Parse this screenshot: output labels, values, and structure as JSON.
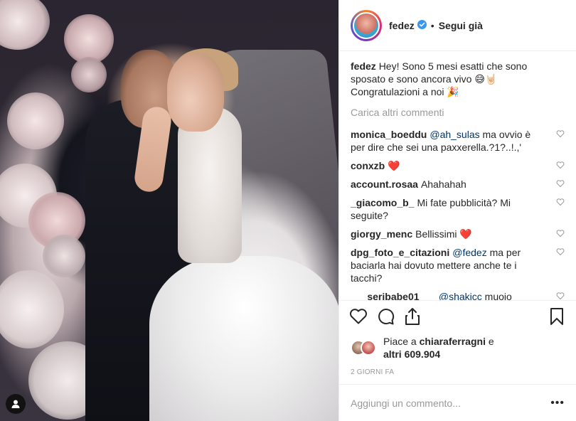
{
  "header": {
    "username": "fedez",
    "separator": "•",
    "follow_label": "Segui già"
  },
  "caption": {
    "username": "fedez",
    "text": "Hey! Sono 5 mesi esatti che sono sposato e sono ancora vivo 😅🤘🏻 Congratulazioni a noi 🎉"
  },
  "load_more_label": "Carica altri commenti",
  "comments": [
    {
      "user": "monica_boeddu",
      "mention": "@ah_sulas",
      "text": " ma ovvio è per dire che sei una paxxerella.?1?..!.,'"
    },
    {
      "user": "conxzb",
      "mention": "",
      "text": "❤️"
    },
    {
      "user": "account.rosaa",
      "mention": "",
      "text": "Ahahahah"
    },
    {
      "user": "_giacomo_b_",
      "mention": "",
      "text": "Mi fate pubblicità? Mi seguite?"
    },
    {
      "user": "giorgy_menc",
      "mention": "",
      "text": "Bellissimi ❤️"
    },
    {
      "user": "dpg_foto_e_citazioni",
      "mention": "@fedez",
      "text": " ma per baciarla hai dovuto mettere anche te i tacchi?"
    },
    {
      "user": "___seribabe01___",
      "mention": "@shakicc",
      "text": " muoio Cristina Ahahahahahahahahahahah"
    }
  ],
  "likes": {
    "prefix": "Piace a ",
    "user": "chiaraferragni",
    "middle": " e",
    "others": "altri 609.904"
  },
  "timestamp": "2 giorni fa",
  "add_comment": {
    "placeholder": "Aggiungi un commento..."
  },
  "more_label": "•••",
  "icons": {
    "verified": "verified-badge-icon",
    "like": "heart-outline-icon",
    "comment": "comment-bubble-icon",
    "share": "share-upload-icon",
    "save": "bookmark-icon",
    "comment_like": "small-heart-icon",
    "tag": "user-tag-icon"
  },
  "colors": {
    "verified_blue": "#3897f0",
    "heart_red": "#ed4956",
    "mention": "#003569",
    "muted": "#999999",
    "text": "#262626"
  }
}
